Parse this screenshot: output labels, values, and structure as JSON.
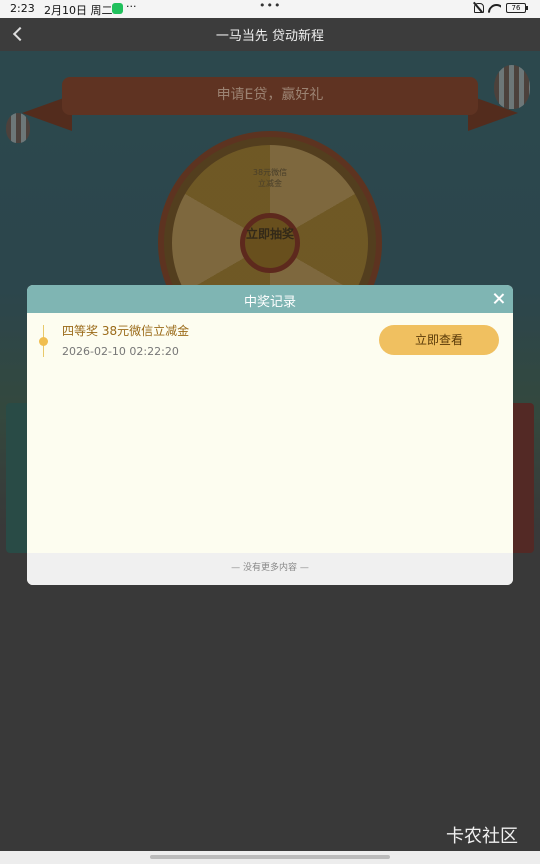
{
  "status_bar": {
    "time": "2:23",
    "date": "2月10日 周二",
    "more": "···",
    "center_dots": "•••",
    "battery": "76"
  },
  "nav": {
    "title": "一马当先 贷动新程"
  },
  "background": {
    "ribbon_text": "申请E贷，赢好礼",
    "wheel_top_label": "38元微信立减金",
    "wheel_hub": "立即抽奖"
  },
  "modal": {
    "title": "中奖记录",
    "records": [
      {
        "prize": "四等奖 38元微信立减金",
        "time": "2026-02-10 02:22:20",
        "button": "立即查看"
      }
    ],
    "footer": "— 没有更多内容 —"
  },
  "watermark": "卡农社区"
}
